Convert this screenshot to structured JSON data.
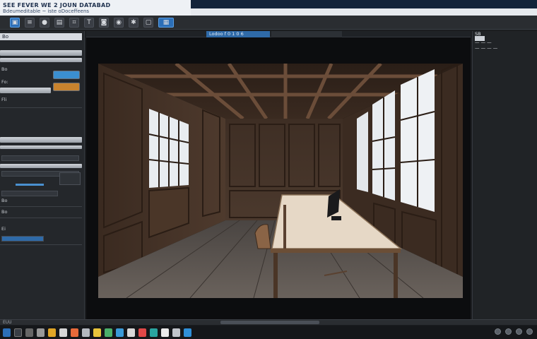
{
  "window": {
    "title": "SEE FEVER WE 2 JOUN DATABAD",
    "subtitle": "Bdeumeditable ~ iste oDoceffeens"
  },
  "toolbar": {
    "icons": [
      "image-icon",
      "layers-icon",
      "brush-icon",
      "file-icon",
      "crop-icon",
      "text-icon",
      "lock-icon",
      "eye-icon",
      "settings-icon",
      "frame-icon",
      "grid-icon"
    ]
  },
  "left_panel": {
    "header": "Bo",
    "rows": [
      "Bo",
      "Fo:",
      "Fli",
      "Bo",
      "Bo",
      "Ei"
    ],
    "swatch_colors": [
      "#3b8fd0",
      "#c8832e"
    ]
  },
  "canvas": {
    "tab_label": "Lodoo f 0 1 0 6"
  },
  "right_panel": {
    "labels": [
      "SB",
      "— — —",
      "— — — —"
    ]
  },
  "status": {
    "text": "EUU"
  }
}
